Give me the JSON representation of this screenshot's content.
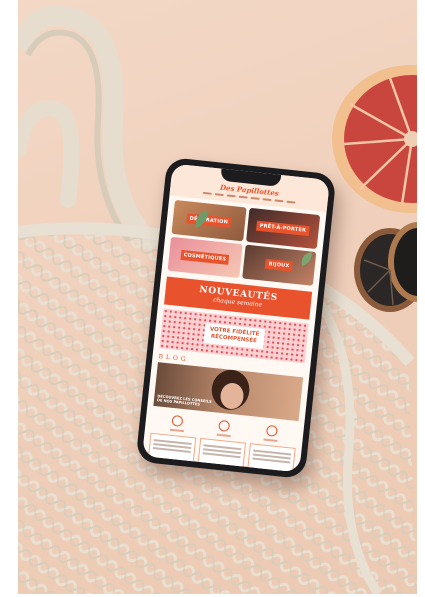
{
  "scene": {
    "background_color": "#efd1bd",
    "accent_color": "#e8532d"
  },
  "site": {
    "brand": "Des Papillottes",
    "nav_item_count_visible": 8,
    "categories": [
      {
        "label": "DÉCORATION"
      },
      {
        "label": "PRÊT-À-PORTER"
      },
      {
        "label": "COSMÉTIQUES"
      },
      {
        "label": "BIJOUX"
      }
    ],
    "promo": {
      "title": "NOUVEAUTÉS",
      "subtitle": "chaque semaine"
    },
    "loyalty": {
      "line1": "VOTRE FIDÉLITÉ",
      "line2": "RÉCOMPENSÉE"
    },
    "blog": {
      "label": "BLOG",
      "caption_line1": "DÉCOUVREZ LES CONSEILS",
      "caption_line2": "DE NOS PAPILLOTTES"
    }
  }
}
